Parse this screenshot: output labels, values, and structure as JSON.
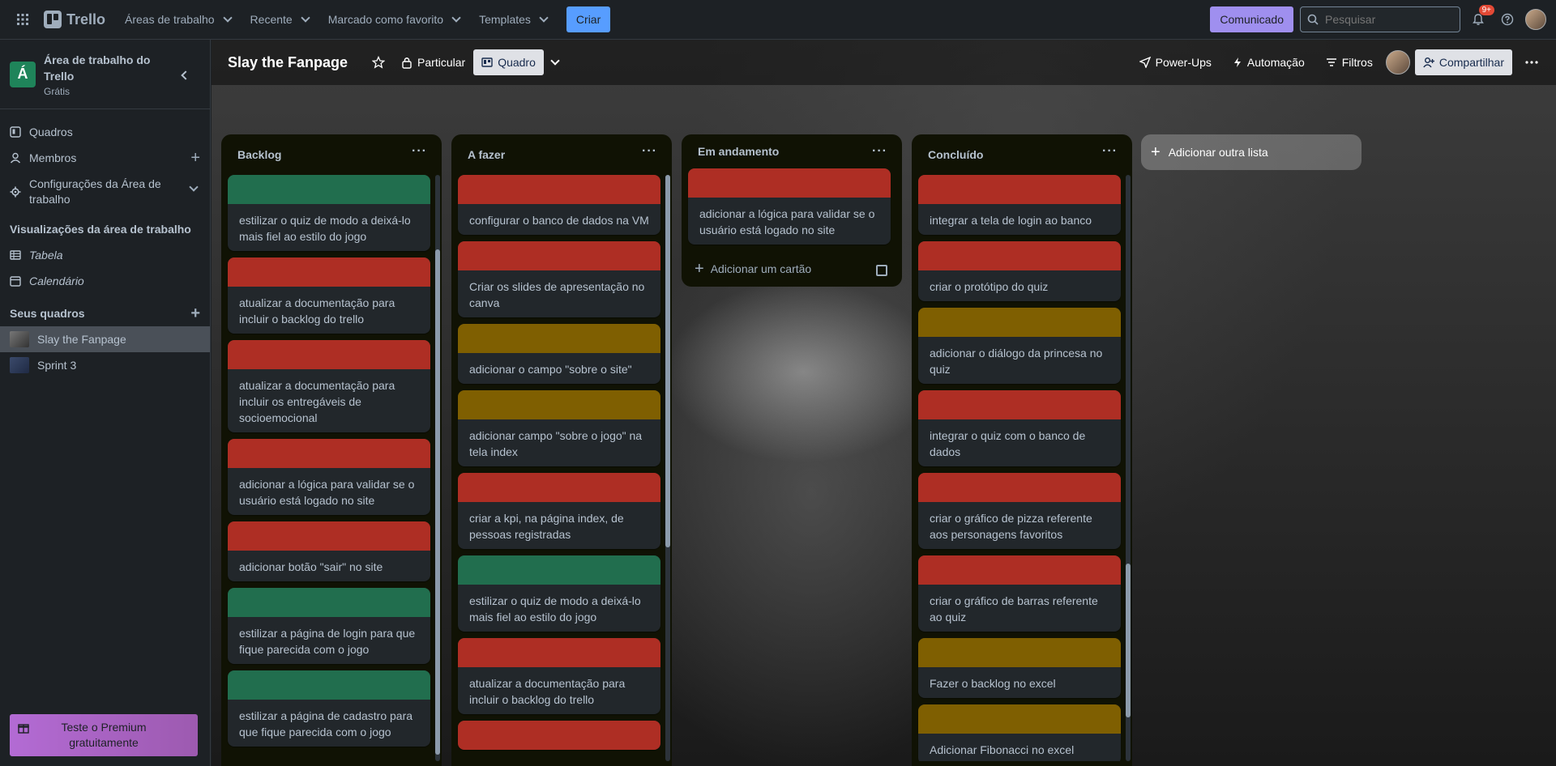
{
  "colors": {
    "green": "#216e4e",
    "red": "#ae2e24",
    "yellow": "#7f5f01",
    "create": "#579dff",
    "comunicado": "#9f8fef"
  },
  "topnav": {
    "logo": "Trello",
    "menus": [
      "Áreas de trabalho",
      "Recente",
      "Marcado como favorito",
      "Templates"
    ],
    "create_label": "Criar",
    "comunicado_label": "Comunicado",
    "search_placeholder": "Pesquisar",
    "notif_badge": "9+"
  },
  "sidebar": {
    "workspace_avatar": "Á",
    "workspace_name": "Área de trabalho do Trello",
    "workspace_plan": "Grátis",
    "items": [
      "Quadros",
      "Membros",
      "Configurações da Área de trabalho"
    ],
    "views_title": "Visualizações da área de trabalho",
    "views": [
      "Tabela",
      "Calendário"
    ],
    "boards_title": "Seus quadros",
    "boards": [
      "Slay the Fanpage",
      "Sprint 3"
    ],
    "premium_line1": "Teste o Premium",
    "premium_line2": "gratuitamente"
  },
  "board": {
    "title": "Slay the Fanpage",
    "visibility": "Particular",
    "view": "Quadro",
    "powerups": "Power-Ups",
    "automation": "Automação",
    "filters": "Filtros",
    "share": "Compartilhar",
    "add_list": "Adicionar outra lista",
    "add_card": "Adicionar um cartão"
  },
  "lists": [
    {
      "title": "Backlog",
      "cards": [
        {
          "color": "green",
          "text": "estilizar o quiz de modo a deixá-lo mais fiel ao estilo do jogo"
        },
        {
          "color": "red",
          "text": "atualizar a documentação para incluir o backlog do trello"
        },
        {
          "color": "red",
          "text": "atualizar a documentação para incluir os entregáveis de socioemocional"
        },
        {
          "color": "red",
          "text": "adicionar a lógica para validar se o usuário está logado no site"
        },
        {
          "color": "red",
          "text": "adicionar botão \"sair\" no site"
        },
        {
          "color": "green",
          "text": "estilizar a página de login para que fique parecida com o jogo"
        },
        {
          "color": "green",
          "text": "estilizar a página de cadastro para que fique parecida com o jogo"
        }
      ]
    },
    {
      "title": "A fazer",
      "cards": [
        {
          "color": "red",
          "text": "configurar o banco de dados na VM"
        },
        {
          "color": "red",
          "text": "Criar os slides de apresentação no canva"
        },
        {
          "color": "yellow",
          "text": "adicionar o campo \"sobre o site\""
        },
        {
          "color": "yellow",
          "text": "adicionar campo \"sobre o jogo\" na tela index"
        },
        {
          "color": "red",
          "text": "criar a kpi, na página index, de pessoas registradas"
        },
        {
          "color": "green",
          "text": "estilizar o quiz de modo a deixá-lo mais fiel ao estilo do jogo"
        },
        {
          "color": "red",
          "text": "atualizar a documentação para incluir o backlog do trello"
        },
        {
          "color": "red",
          "text": ""
        }
      ]
    },
    {
      "title": "Em andamento",
      "cards": [
        {
          "color": "red",
          "text": "adicionar a lógica para validar se o usuário está logado no site"
        }
      ]
    },
    {
      "title": "Concluído",
      "cards": [
        {
          "color": "red",
          "text": "integrar a tela de login ao banco"
        },
        {
          "color": "red",
          "text": "criar o protótipo do quiz"
        },
        {
          "color": "yellow",
          "text": "adicionar o diálogo da princesa no quiz"
        },
        {
          "color": "red",
          "text": "integrar o quiz com o banco de dados"
        },
        {
          "color": "red",
          "text": "criar o gráfico de pizza referente aos personagens favoritos"
        },
        {
          "color": "red",
          "text": "criar o gráfico de barras referente ao quiz"
        },
        {
          "color": "yellow",
          "text": "Fazer o backlog no excel"
        },
        {
          "color": "yellow",
          "text": "Adicionar Fibonacci no excel"
        }
      ]
    }
  ]
}
